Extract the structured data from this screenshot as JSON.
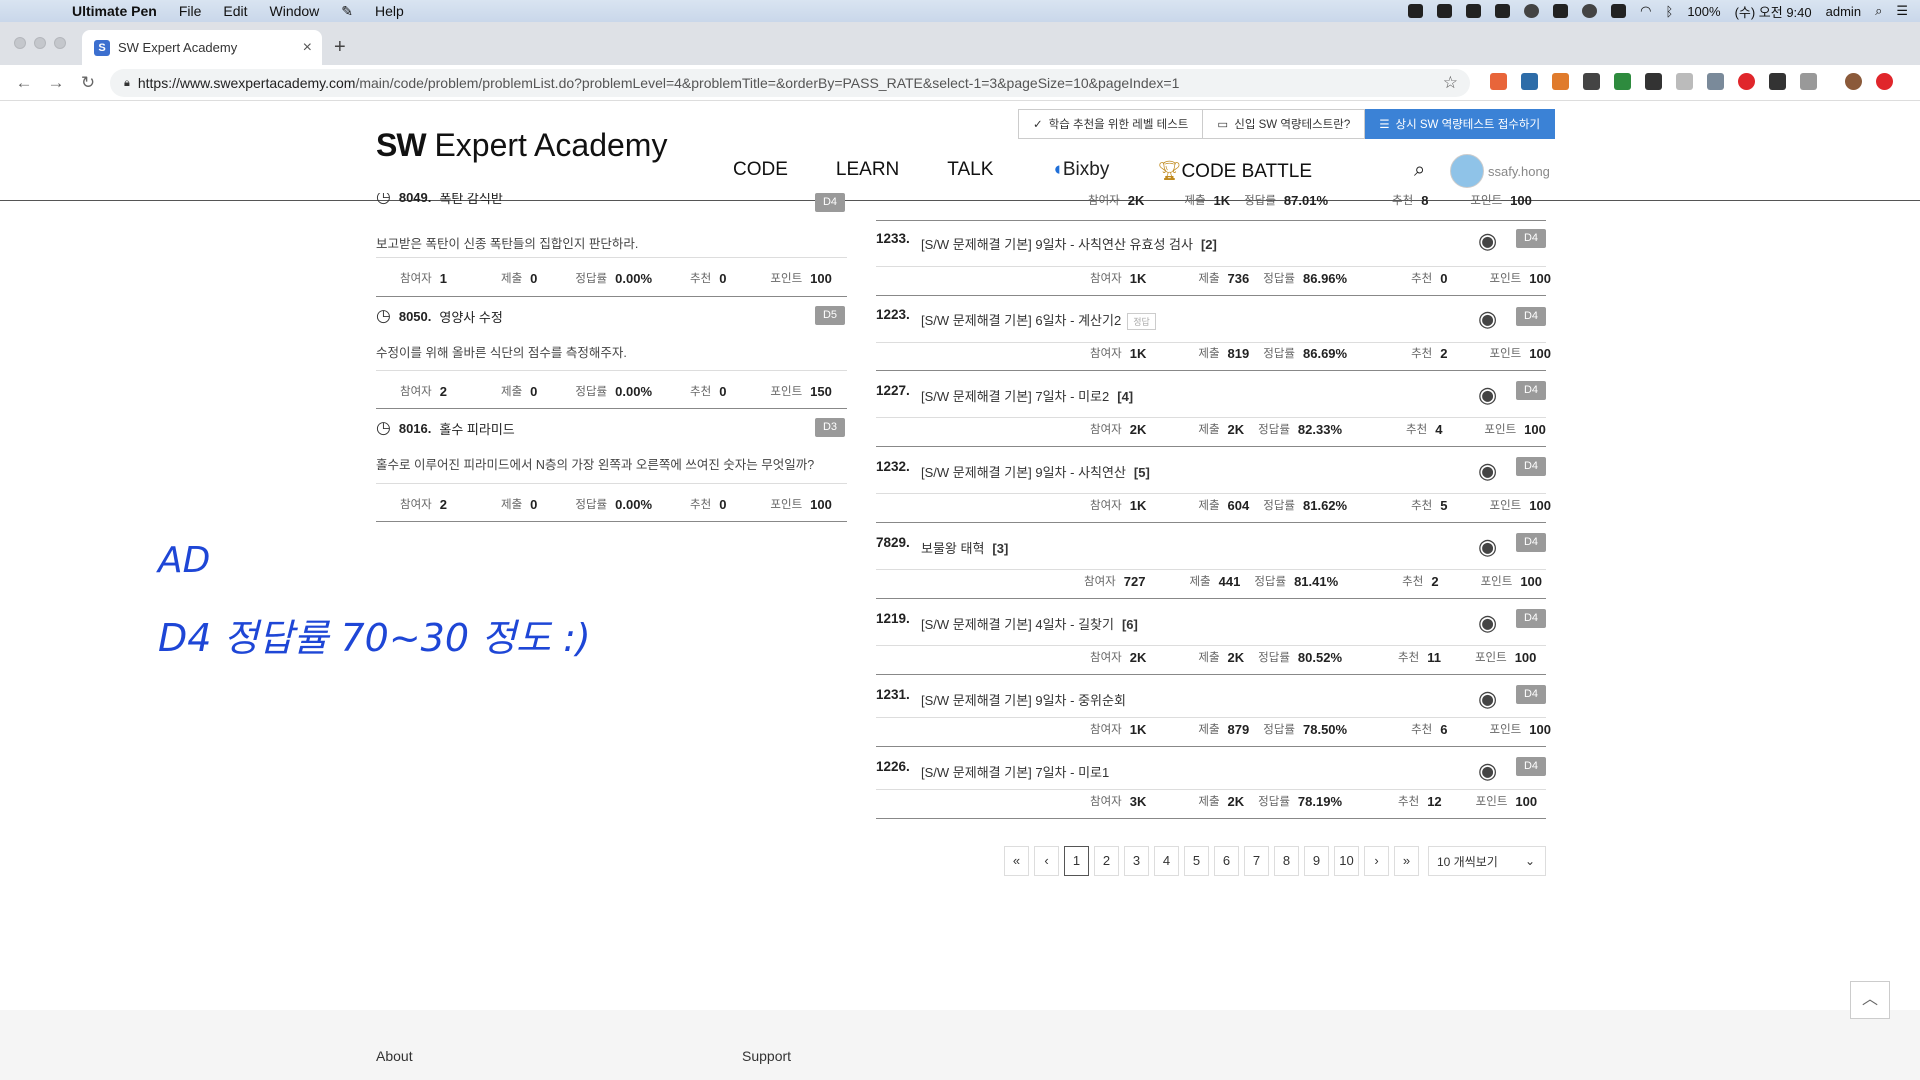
{
  "menubar": {
    "app_name": "Ultimate Pen",
    "menus": [
      "File",
      "Edit",
      "Window",
      "Help"
    ],
    "battery": "100%",
    "clock": "(수) 오전 9:40",
    "user": "admin"
  },
  "browser": {
    "tab_title": "SW Expert Academy",
    "url_host": "https://www.swexpertacademy.com",
    "url_path": "/main/code/problem/problemList.do?problemLevel=4&problemTitle=&orderBy=PASS_RATE&select-1=3&pageSize=10&pageIndex=1"
  },
  "site": {
    "logo_bold": "SW",
    "logo_rest": " Expert Academy",
    "top_buttons": [
      "학습 추천을 위한 레벨 테스트",
      "신입 SW 역량테스트란?",
      "상시 SW 역량테스트 접수하기"
    ],
    "nav": [
      "CODE",
      "LEARN",
      "TALK",
      "Bixby",
      "CODE BATTLE"
    ],
    "username": "ssafy.hong"
  },
  "labels": {
    "participants": "참여자",
    "submissions": "제출",
    "pass_rate": "정답률",
    "recommend": "추천",
    "points": "포인트"
  },
  "left_list": [
    {
      "id": "8049.",
      "title": "폭탄 감식반",
      "level": "D4",
      "desc": "보고받은 폭탄이 신종 폭탄들의 집합인지 판단하라.",
      "participants": "1",
      "submissions": "0",
      "pass_rate": "0.00%",
      "recommend": "0",
      "points": "100"
    },
    {
      "id": "8050.",
      "title": "영양사 수정",
      "level": "D5",
      "desc": "수정이를 위해 올바른 식단의 점수를 측정해주자.",
      "participants": "2",
      "submissions": "0",
      "pass_rate": "0.00%",
      "recommend": "0",
      "points": "150"
    },
    {
      "id": "8016.",
      "title": "홀수 피라미드",
      "level": "D3",
      "desc": "홀수로 이루어진 피라미드에서 N층의 가장 왼쪽과 오른쪽에 쓰여진 숫자는 무엇일까?",
      "participants": "2",
      "submissions": "0",
      "pass_rate": "0.00%",
      "recommend": "0",
      "points": "100"
    }
  ],
  "top_partial_row": {
    "participants": "2K",
    "submissions": "1K",
    "pass_rate": "87.01%",
    "recommend": "8",
    "points": "100"
  },
  "right_list": [
    {
      "id": "1233.",
      "title": "[S/W 문제해결 기본] 9일차 - 사칙연산 유효성 검사",
      "count": "[2]",
      "tag": "",
      "level": "D4",
      "participants": "1K",
      "submissions": "736",
      "pass_rate": "86.96%",
      "recommend": "0",
      "points": "100"
    },
    {
      "id": "1223.",
      "title": "[S/W 문제해결 기본] 6일차 - 계산기2",
      "count": "",
      "tag": "정답",
      "level": "D4",
      "participants": "1K",
      "submissions": "819",
      "pass_rate": "86.69%",
      "recommend": "2",
      "points": "100"
    },
    {
      "id": "1227.",
      "title": "[S/W 문제해결 기본] 7일차 - 미로2",
      "count": "[4]",
      "tag": "",
      "level": "D4",
      "participants": "2K",
      "submissions": "2K",
      "pass_rate": "82.33%",
      "recommend": "4",
      "points": "100"
    },
    {
      "id": "1232.",
      "title": "[S/W 문제해결 기본] 9일차 - 사칙연산",
      "count": "[5]",
      "tag": "",
      "level": "D4",
      "participants": "1K",
      "submissions": "604",
      "pass_rate": "81.62%",
      "recommend": "5",
      "points": "100"
    },
    {
      "id": "7829.",
      "title": "보물왕 태혁",
      "count": "[3]",
      "tag": "",
      "level": "D4",
      "participants": "727",
      "submissions": "441",
      "pass_rate": "81.41%",
      "recommend": "2",
      "points": "100"
    },
    {
      "id": "1219.",
      "title": "[S/W 문제해결 기본] 4일차 - 길찾기",
      "count": "[6]",
      "tag": "",
      "level": "D4",
      "participants": "2K",
      "submissions": "2K",
      "pass_rate": "80.52%",
      "recommend": "11",
      "points": "100"
    },
    {
      "id": "1231.",
      "title": "[S/W 문제해결 기본] 9일차 - 중위순회",
      "count": "",
      "tag": "",
      "level": "D4",
      "participants": "1K",
      "submissions": "879",
      "pass_rate": "78.50%",
      "recommend": "6",
      "points": "100"
    },
    {
      "id": "1226.",
      "title": "[S/W 문제해결 기본] 7일차 - 미로1",
      "count": "",
      "tag": "",
      "level": "D4",
      "participants": "3K",
      "submissions": "2K",
      "pass_rate": "78.19%",
      "recommend": "12",
      "points": "100"
    }
  ],
  "handwriting": {
    "line1": "AD",
    "line2": "D4 정답률 70~30 정도 :)"
  },
  "pager": {
    "first": "«",
    "prev": "‹",
    "pages": [
      "1",
      "2",
      "3",
      "4",
      "5",
      "6",
      "7",
      "8",
      "9",
      "10"
    ],
    "current": "1",
    "next": "›",
    "last": "»",
    "page_size": "10 개씩보기"
  },
  "footer": {
    "about": "About",
    "support": "Support"
  },
  "colors": {
    "accent": "#3b82d6",
    "level_badge": "#9a9a9a",
    "ink": "#1e46d6"
  }
}
